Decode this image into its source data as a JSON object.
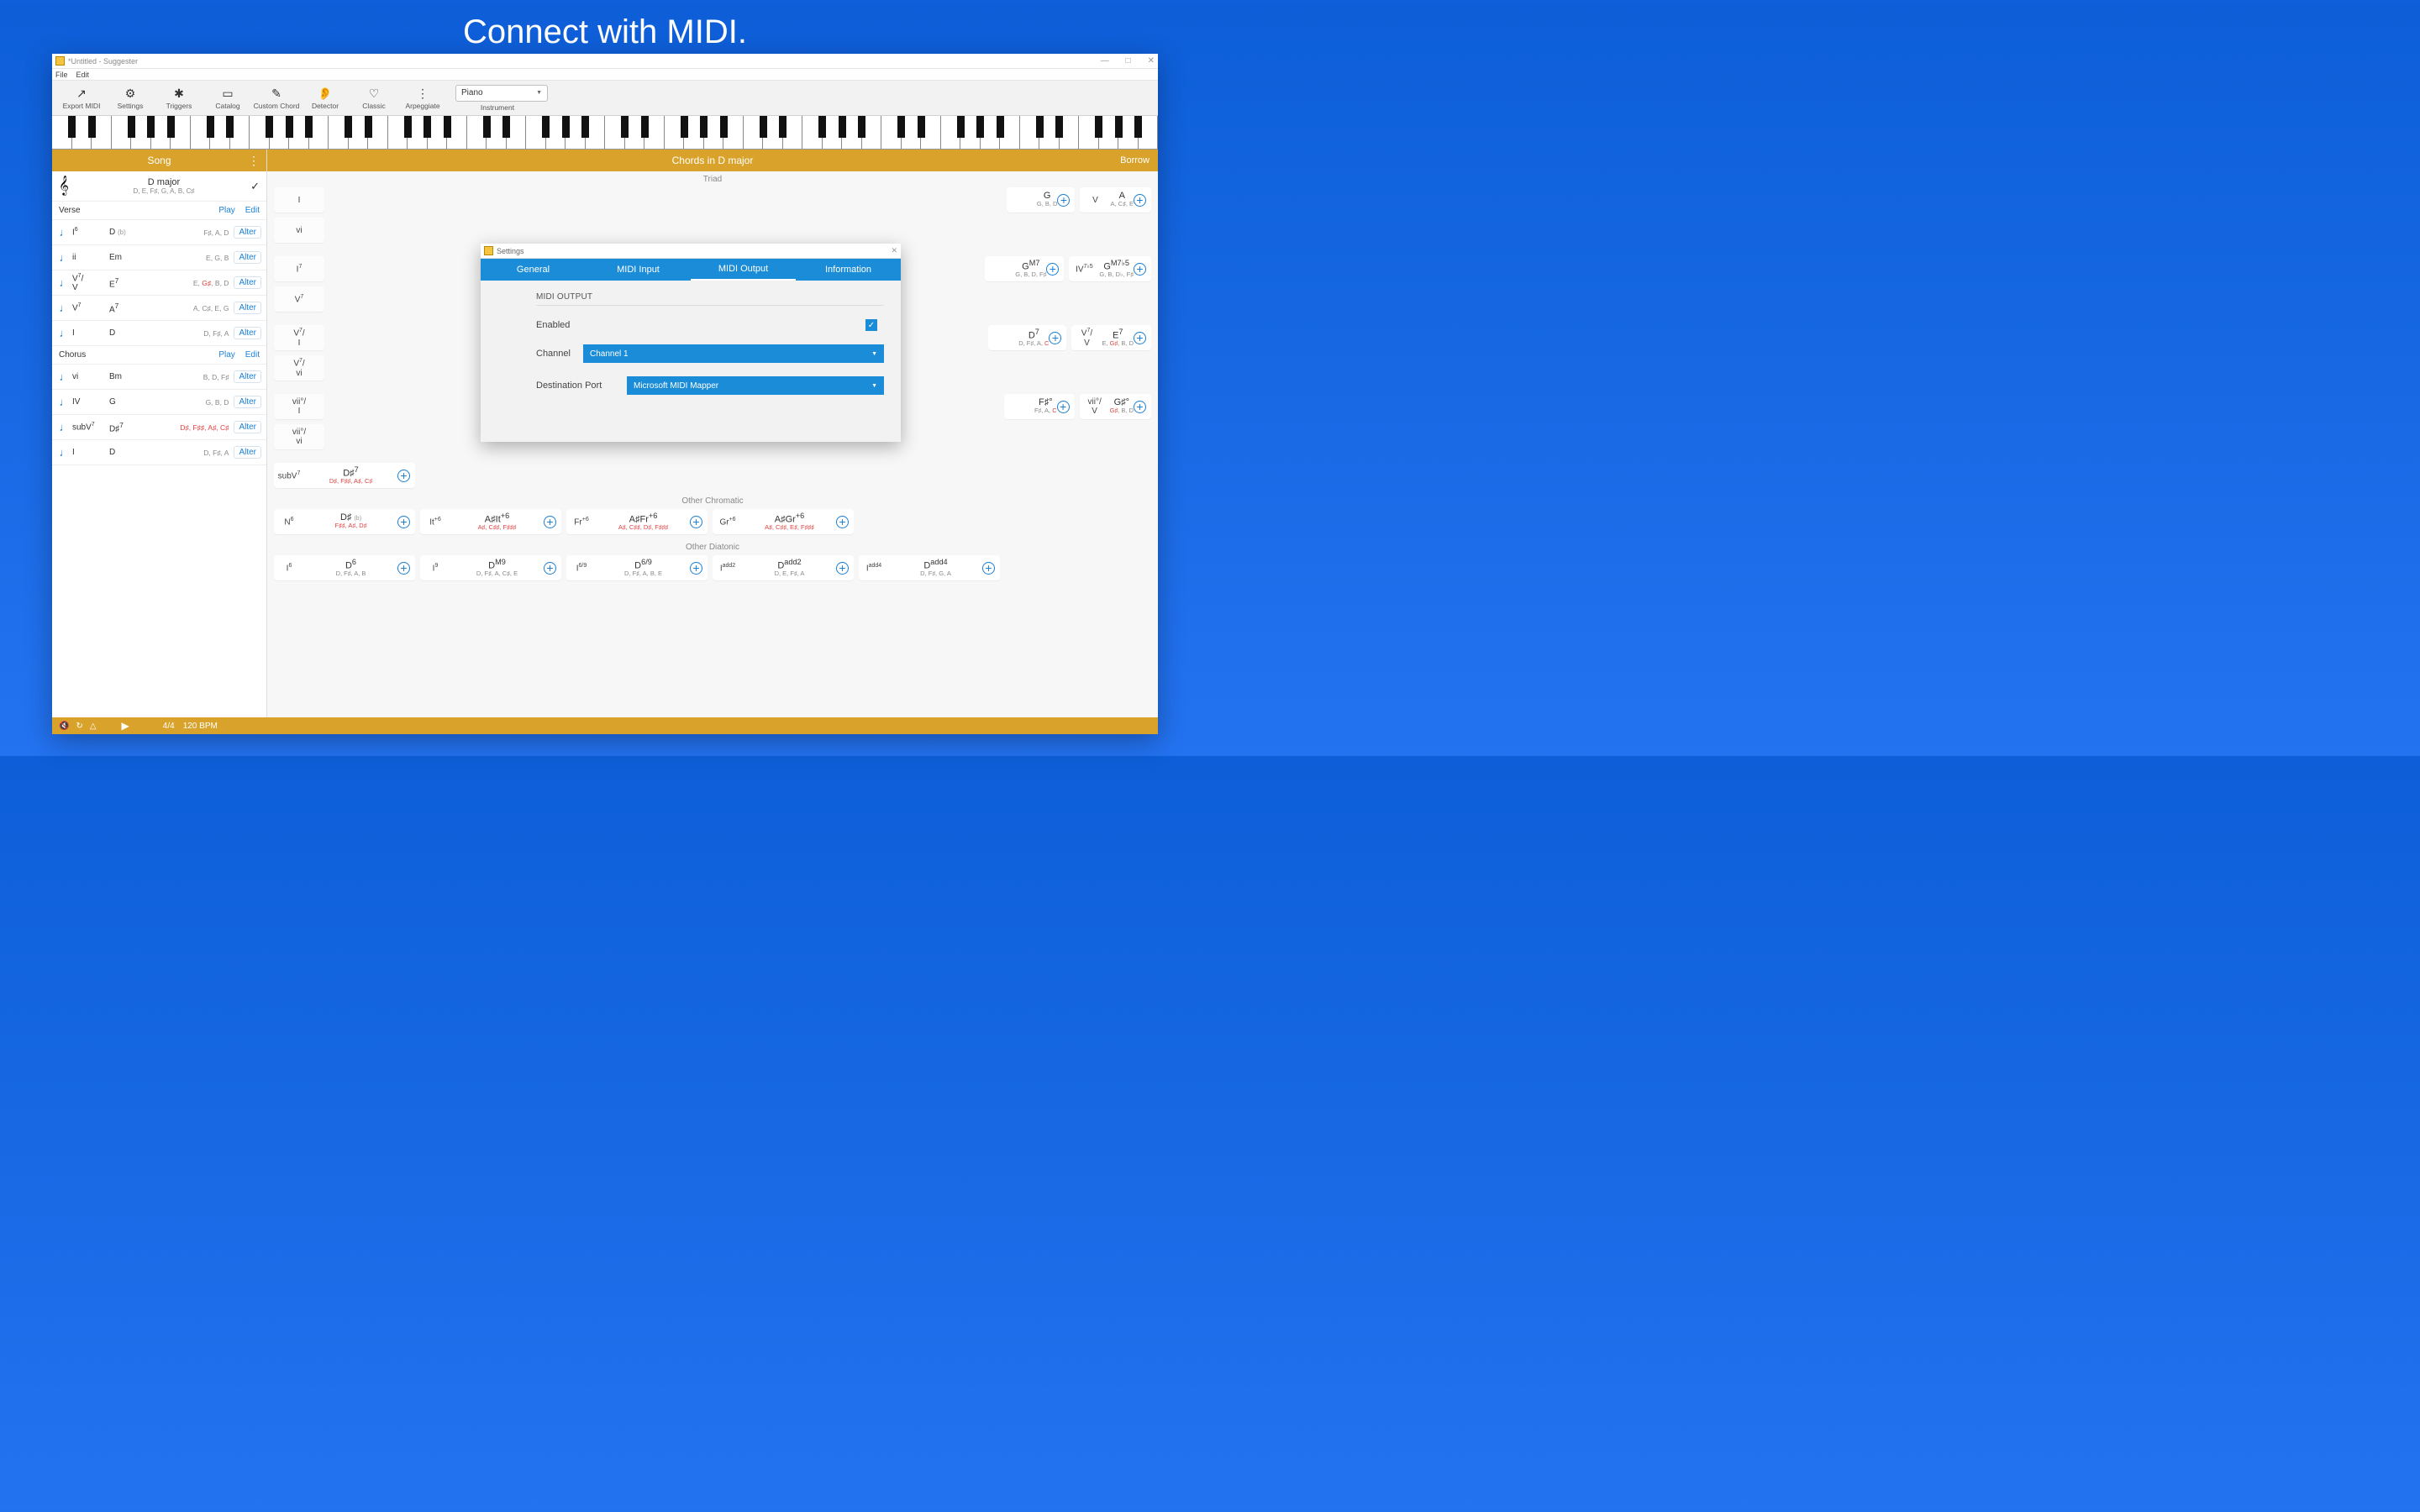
{
  "hero": "Connect with MIDI.",
  "window": {
    "title": "*Untitled - Suggester",
    "min": "—",
    "max": "□",
    "close": "✕"
  },
  "menubar": [
    "File",
    "Edit"
  ],
  "toolbar": {
    "items": [
      {
        "label": "Export MIDI",
        "glyph": "share"
      },
      {
        "label": "Settings",
        "glyph": "gear"
      },
      {
        "label": "Triggers",
        "glyph": "asterisk"
      },
      {
        "label": "Catalog",
        "glyph": "book"
      },
      {
        "label": "Custom Chord",
        "glyph": "hammer"
      },
      {
        "label": "Detector",
        "glyph": "ear"
      },
      {
        "label": "Classic",
        "glyph": "heart"
      },
      {
        "label": "Arpeggiate",
        "glyph": "dots"
      }
    ],
    "instrument_label": "Instrument",
    "instrument_value": "Piano"
  },
  "song_header": "Song",
  "key": {
    "name": "D major",
    "notes": "D, E, F♯, G, A, B, C♯"
  },
  "sections": [
    {
      "name": "Verse",
      "play": "Play",
      "edit": "Edit",
      "chords": [
        {
          "roman": "I<sup>6</sup>",
          "chord": "D",
          "ext": "(b)",
          "notes": "F♯, A, D",
          "alter": "Alter"
        },
        {
          "roman": "ii",
          "chord": "Em",
          "notes": "E, G, B",
          "alter": "Alter"
        },
        {
          "roman": "V<sup>7</sup>/<br>V",
          "chord": "E<sup>7</sup>",
          "notes": "E, <span class='red'>G♯</span>, B, D",
          "alter": "Alter"
        },
        {
          "roman": "V<sup>7</sup>",
          "chord": "A<sup>7</sup>",
          "notes": "A, C♯, E, G",
          "alter": "Alter"
        },
        {
          "roman": "I",
          "chord": "D",
          "notes": "D, F♯, A",
          "alter": "Alter"
        }
      ]
    },
    {
      "name": "Chorus",
      "play": "Play",
      "edit": "Edit",
      "chords": [
        {
          "roman": "vi",
          "chord": "Bm",
          "notes": "B, D, F♯",
          "alter": "Alter"
        },
        {
          "roman": "IV",
          "chord": "G",
          "notes": "G, B, D",
          "alter": "Alter"
        },
        {
          "roman": "subV<sup>7</sup>",
          "chord": "D♯<sup>7</sup>",
          "notes": "<span class='red'>D♯, F♯♯, A♯, C♯</span>",
          "alter": "Alter"
        },
        {
          "roman": "I",
          "chord": "D",
          "notes": "D, F♯, A",
          "alter": "Alter"
        }
      ]
    }
  ],
  "chords_header": "Chords in D major",
  "borrow": "Borrow",
  "cat_triad": "Triad",
  "triad_cards": [
    {
      "rn": "I"
    },
    {
      "rn": "vi"
    }
  ],
  "right_triad": [
    {
      "rn": "",
      "big": "G",
      "sm": "G, B, D"
    },
    {
      "rn": "V",
      "big": "A",
      "sm": "A, C♯, E"
    }
  ],
  "rnrows": [
    "I<sup>7</sup>",
    "V<sup>7</sup>",
    "V<sup>7</sup>/<br>I",
    "V<sup>7</sup>/<br>vi",
    "vii°/<br>I",
    "vii°/<br>vi"
  ],
  "right_m7": [
    {
      "rn": "",
      "big": "G<sup>M7</sup>",
      "sm": "G, B, D, F♯"
    },
    {
      "rn": "IV<sup>7♭5</sup>",
      "big": "G<sup>M7♭5</sup>",
      "sm": "G, B, D♭, F♯"
    }
  ],
  "right_d7": [
    {
      "rn": "",
      "big": "D<sup>7</sup>",
      "sm": "D, F♯, A, <span class='red'>C</span>"
    },
    {
      "rn": "V<sup>7</sup>/<br>V",
      "big": "E<sup>7</sup>",
      "sm": "E, <span class='red'>G♯</span>, B, D"
    }
  ],
  "right_dim": [
    {
      "rn": "",
      "big": "F♯°",
      "sm": "F♯, A, <span class='red'>C</span>"
    },
    {
      "rn": "vii°/<br>V",
      "big": "G♯°",
      "sm": "<span class='red'>G♯</span>, B, D"
    }
  ],
  "subv": {
    "rn": "subV<sup>7</sup>",
    "big": "D♯<sup>7</sup>",
    "sm": "<span class='red'>D♯, F♯♯, A♯, C♯</span>"
  },
  "cat_chrom": "Other Chromatic",
  "chrom": [
    {
      "rn": "N<sup>6</sup>",
      "big": "D♯ <span style='font-size:7px;color:#999'>(b)</span>",
      "sm": "<span class='red'>F♯♯, A♯, D♯</span>"
    },
    {
      "rn": "It<sup>+6</sup>",
      "big": "A♯It<sup>+6</sup>",
      "sm": "<span class='red'>A♯, C♯♯, F♯♯♯</span>"
    },
    {
      "rn": "Fr<sup>+6</sup>",
      "big": "A♯Fr<sup>+6</sup>",
      "sm": "<span class='red'>A♯, C♯♯, D♯, F♯♯♯</span>"
    },
    {
      "rn": "Gr<sup>+6</sup>",
      "big": "A♯Gr<sup>+6</sup>",
      "sm": "<span class='red'>A♯, C♯♯, E♯, F♯♯♯</span>"
    }
  ],
  "cat_diat": "Other Diatonic",
  "diat": [
    {
      "rn": "I<sup>6</sup>",
      "big": "D<sup>6</sup>",
      "sm": "D, F♯, A, B"
    },
    {
      "rn": "I<sup>9</sup>",
      "big": "D<sup>M9</sup>",
      "sm": "D, F♯, A, C♯, E"
    },
    {
      "rn": "I<sup>6/9</sup>",
      "big": "D<sup>6/9</sup>",
      "sm": "D, F♯, A, B, E"
    },
    {
      "rn": "I<sup>add2</sup>",
      "big": "D<sup>add2</sup>",
      "sm": "D, E, F♯, A"
    },
    {
      "rn": "I<sup>add4</sup>",
      "big": "D<sup>add4</sup>",
      "sm": "D, F♯, G, A"
    }
  ],
  "transport": {
    "timesig": "4/4",
    "bpm": "120 BPM"
  },
  "dialog": {
    "title": "Settings",
    "tabs": [
      "General",
      "MIDI Input",
      "MIDI Output",
      "Information"
    ],
    "active_tab": 2,
    "section": "MIDI OUTPUT",
    "enabled_label": "Enabled",
    "channel_label": "Channel",
    "channel_value": "Channel 1",
    "port_label": "Destination Port",
    "port_value": "Microsoft MIDI Mapper"
  }
}
